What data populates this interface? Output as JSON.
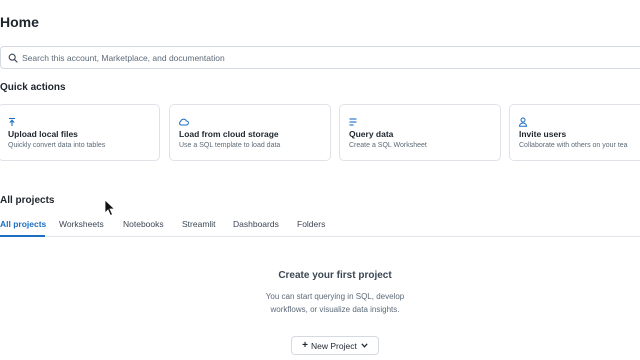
{
  "header": {
    "title": "Home"
  },
  "search": {
    "placeholder": "Search this account, Marketplace, and documentation"
  },
  "quick_actions": {
    "title": "Quick actions",
    "cards": [
      {
        "title": "Upload local files",
        "desc": "Quickly convert data into tables",
        "icon": "upload-icon"
      },
      {
        "title": "Load from cloud storage",
        "desc": "Use a SQL template to load data",
        "icon": "cloud-icon"
      },
      {
        "title": "Query data",
        "desc": "Create a SQL Worksheet",
        "icon": "list-icon"
      },
      {
        "title": "Invite users",
        "desc": "Collaborate with others on your tea",
        "icon": "user-icon"
      }
    ]
  },
  "projects": {
    "title": "All projects",
    "tabs": [
      {
        "label": "All projects",
        "active": true
      },
      {
        "label": "Worksheets"
      },
      {
        "label": "Notebooks"
      },
      {
        "label": "Streamlit"
      },
      {
        "label": "Dashboards"
      },
      {
        "label": "Folders"
      }
    ],
    "empty": {
      "title": "Create your first project",
      "line1": "You can start querying in SQL, develop",
      "line2": "workflows, or visualize data insights."
    },
    "new_button": "New Project"
  },
  "colors": {
    "accent": "#1b6ec2",
    "text": "#1e252d",
    "muted": "#5d6a78",
    "border": "#dfe3e8"
  }
}
